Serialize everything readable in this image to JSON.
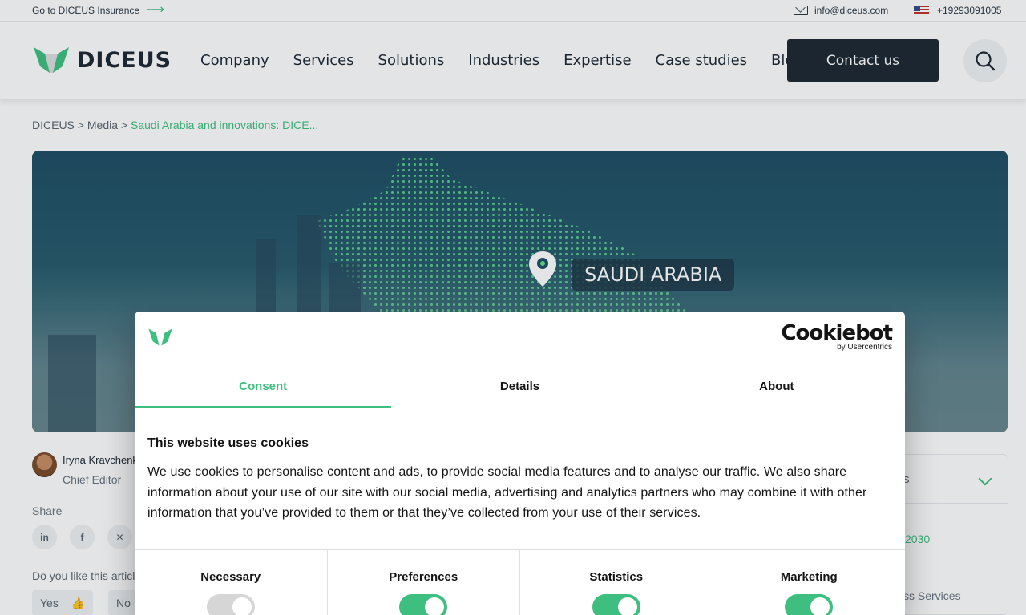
{
  "topbar": {
    "goto_text": "Go to DICEUS Insurance",
    "email": "info@diceus.com",
    "phone": "+19293091005"
  },
  "header": {
    "logo_text": "DICEUS",
    "nav": [
      "Company",
      "Services",
      "Solutions",
      "Industries",
      "Expertise",
      "Case studies",
      "Blog"
    ],
    "contact_label": "Contact us"
  },
  "breadcrumb": {
    "root": "DICEUS",
    "sep": ">",
    "media": "Media",
    "current": "Saudi Arabia and innovations: DICE..."
  },
  "hero": {
    "label": "SAUDI ARABIA"
  },
  "author": {
    "name": "Iryna Kravchenk",
    "role": "Chief Editor",
    "share_label": "Share",
    "share_icons": [
      "linkedin-icon",
      "facebook-icon",
      "x-icon"
    ],
    "like_question": "Do you like this articl",
    "yes": "Yes",
    "no": "No"
  },
  "toc": {
    "heading_fragment": "s",
    "item_fragment": "2030",
    "item2_fragment": "ss Services"
  },
  "cookie_dialog": {
    "brand": "Cookiebot",
    "brand_by": "by Usercentrics",
    "tabs": [
      {
        "label": "Consent",
        "active": true
      },
      {
        "label": "Details",
        "active": false
      },
      {
        "label": "About",
        "active": false
      }
    ],
    "title": "This website uses cookies",
    "body": "We use cookies to personalise content and ads, to provide social media features and to analyse our traffic. We also share information about your use of our site with our social media, advertising and analytics partners who may combine it with other information that you’ve provided to them or that they’ve collected from your use of their services.",
    "categories": [
      {
        "label": "Necessary",
        "enabled": true,
        "locked": true
      },
      {
        "label": "Preferences",
        "enabled": true
      },
      {
        "label": "Statistics",
        "enabled": true
      },
      {
        "label": "Marketing",
        "enabled": true
      }
    ]
  },
  "colors": {
    "accent": "#3fbf7f",
    "dark": "#1d2733"
  }
}
